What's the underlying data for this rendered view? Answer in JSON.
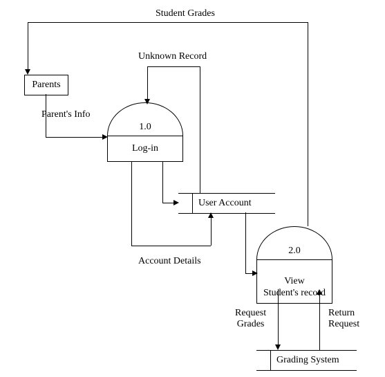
{
  "entities": {
    "parents": "Parents"
  },
  "processes": {
    "p1": {
      "id": "1.0",
      "name": "Log-in"
    },
    "p2": {
      "id": "2.0",
      "name": "View\nStudent's record"
    }
  },
  "datastores": {
    "user_account": "User Account",
    "grading_system": "Grading System"
  },
  "flows": {
    "student_grades": "Student Grades",
    "unknown_record": "Unknown Record",
    "parents_info": "Parent's Info",
    "account_details": "Account Details",
    "request_grades": "Request\nGrades",
    "return_request": "Return\nRequest"
  }
}
